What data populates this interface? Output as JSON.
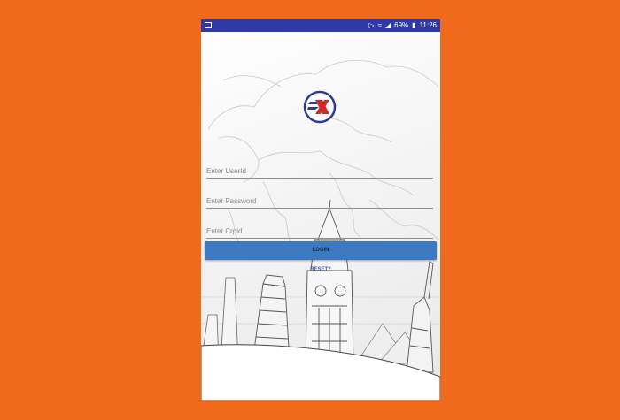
{
  "status_bar": {
    "battery": "69%",
    "time": "11:26"
  },
  "form": {
    "userid_placeholder": "Enter UserId",
    "password_placeholder": "Enter Password",
    "corpid_placeholder": "Enter Crpid",
    "login_label": "LOGIN",
    "reset_label": "RESET?"
  },
  "colors": {
    "background": "#ef6a1c",
    "status_bar": "#2f3aa6",
    "login_button": "#3b7ac2",
    "logo_ring": "#2c3d8f",
    "logo_x": "#d32a2a"
  }
}
